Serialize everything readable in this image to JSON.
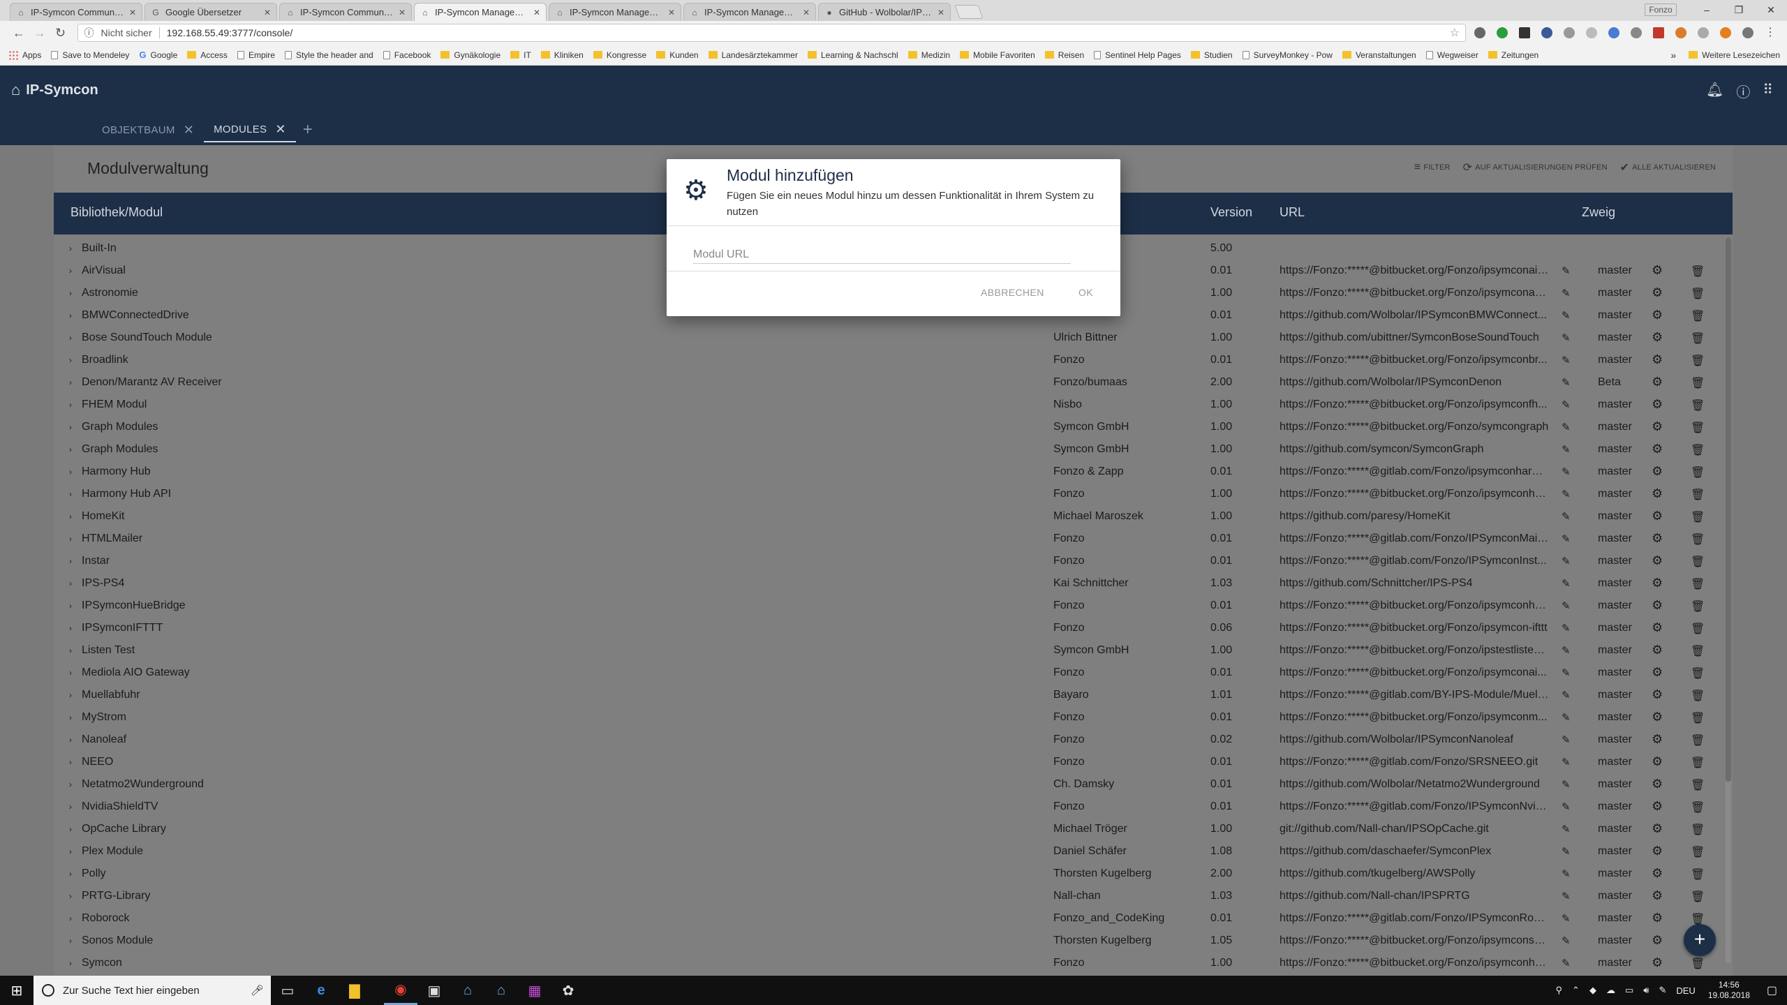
{
  "browser": {
    "tabs": [
      {
        "title": "IP-Symcon Community F",
        "icon": "home-icon",
        "active": false
      },
      {
        "title": "Google Übersetzer",
        "icon": "translate-icon",
        "active": false
      },
      {
        "title": "IP-Symcon Community F",
        "icon": "home-icon",
        "active": false
      },
      {
        "title": "IP-Symcon Management",
        "icon": "home-icon",
        "active": true
      },
      {
        "title": "IP-Symcon Management",
        "icon": "home-icon",
        "active": false
      },
      {
        "title": "IP-Symcon Management",
        "icon": "home-icon",
        "active": false
      },
      {
        "title": "GitHub - Wolbolar/IPSym",
        "icon": "github-icon",
        "active": false
      }
    ],
    "user_label": "Fonzo",
    "security_label": "Nicht sicher",
    "url": "192.168.55.49:3777/console/",
    "bookmarks": [
      {
        "label": "Apps",
        "type": "apps"
      },
      {
        "label": "Save to Mendeley",
        "type": "page"
      },
      {
        "label": "Google",
        "type": "google"
      },
      {
        "label": "Access",
        "type": "folder"
      },
      {
        "label": "Empire",
        "type": "page"
      },
      {
        "label": "Style the header and",
        "type": "page"
      },
      {
        "label": "Facebook",
        "type": "page"
      },
      {
        "label": "Gynäkologie",
        "type": "folder"
      },
      {
        "label": "IT",
        "type": "folder"
      },
      {
        "label": "Kliniken",
        "type": "folder"
      },
      {
        "label": "Kongresse",
        "type": "folder"
      },
      {
        "label": "Kunden",
        "type": "folder"
      },
      {
        "label": "Landesärztekammer",
        "type": "folder"
      },
      {
        "label": "Learning & Nachschl",
        "type": "folder"
      },
      {
        "label": "Medizin",
        "type": "folder"
      },
      {
        "label": "Mobile Favoriten",
        "type": "folder"
      },
      {
        "label": "Reisen",
        "type": "folder"
      },
      {
        "label": "Sentinel Help Pages",
        "type": "page"
      },
      {
        "label": "Studien",
        "type": "folder"
      },
      {
        "label": "SurveyMonkey - Pow",
        "type": "page"
      },
      {
        "label": "Veranstaltungen",
        "type": "folder"
      },
      {
        "label": "Wegweiser",
        "type": "page"
      },
      {
        "label": "Zeitungen",
        "type": "folder"
      }
    ],
    "more_bookmarks": "»",
    "other_bookmarks": "Weitere Lesezeichen"
  },
  "app": {
    "brand": "IP-Symcon",
    "tabs": [
      {
        "label": "OBJEKTBAUM",
        "active": false
      },
      {
        "label": "MODULES",
        "active": true
      }
    ],
    "add_tab": "+"
  },
  "page": {
    "title": "Modulverwaltung",
    "actions": {
      "filter": "FILTER",
      "check_updates": "AUF AKTUALISIERUNGEN PRÜFEN",
      "update_all": "ALLE AKTUALISIEREN"
    },
    "columns": {
      "library": "Bibliothek/Modul",
      "version": "Version",
      "url": "URL",
      "branch": "Zweig"
    },
    "rows": [
      {
        "name": "Built-In",
        "author": "",
        "version": "5.00",
        "url": "",
        "branch": ""
      },
      {
        "name": "AirVisual",
        "author": "",
        "version": "0.01",
        "url": "https://Fonzo:*****@bitbucket.org/Fonzo/ipsymconair...",
        "branch": "master"
      },
      {
        "name": "Astronomie",
        "author": "",
        "version": "1.00",
        "url": "https://Fonzo:*****@bitbucket.org/Fonzo/ipsymconas...",
        "branch": "master"
      },
      {
        "name": "BMWConnectedDrive",
        "author": "",
        "version": "0.01",
        "url": "https://github.com/Wolbolar/IPSymconBMWConnect...",
        "branch": "master"
      },
      {
        "name": "Bose SoundTouch Module",
        "author": "Ulrich Bittner",
        "version": "1.00",
        "url": "https://github.com/ubittner/SymconBoseSoundTouch",
        "branch": "master"
      },
      {
        "name": "Broadlink",
        "author": "Fonzo",
        "version": "0.01",
        "url": "https://Fonzo:*****@bitbucket.org/Fonzo/ipsymconbr...",
        "branch": "master"
      },
      {
        "name": "Denon/Marantz AV Receiver",
        "author": "Fonzo/bumaas",
        "version": "2.00",
        "url": "https://github.com/Wolbolar/IPSymconDenon",
        "branch": "Beta"
      },
      {
        "name": "FHEM Modul",
        "author": "Nisbo",
        "version": "1.00",
        "url": "https://Fonzo:*****@bitbucket.org/Fonzo/ipsymconfh...",
        "branch": "master"
      },
      {
        "name": "Graph Modules",
        "author": "Symcon GmbH",
        "version": "1.00",
        "url": "https://Fonzo:*****@bitbucket.org/Fonzo/symcongraph",
        "branch": "master"
      },
      {
        "name": "Graph Modules",
        "author": "Symcon GmbH",
        "version": "1.00",
        "url": "https://github.com/symcon/SymconGraph",
        "branch": "master"
      },
      {
        "name": "Harmony Hub",
        "author": "Fonzo & Zapp",
        "version": "0.01",
        "url": "https://Fonzo:*****@gitlab.com/Fonzo/ipsymconharm...",
        "branch": "master"
      },
      {
        "name": "Harmony Hub API",
        "author": "Fonzo",
        "version": "1.00",
        "url": "https://Fonzo:*****@bitbucket.org/Fonzo/ipsymconha...",
        "branch": "master"
      },
      {
        "name": "HomeKit",
        "author": "Michael Maroszek",
        "version": "1.00",
        "url": "https://github.com/paresy/HomeKit",
        "branch": "master"
      },
      {
        "name": "HTMLMailer",
        "author": "Fonzo",
        "version": "0.01",
        "url": "https://Fonzo:*****@gitlab.com/Fonzo/IPSymconMail...",
        "branch": "master"
      },
      {
        "name": "Instar",
        "author": "Fonzo",
        "version": "0.01",
        "url": "https://Fonzo:*****@gitlab.com/Fonzo/IPSymconInst...",
        "branch": "master"
      },
      {
        "name": "IPS-PS4",
        "author": "Kai Schnittcher",
        "version": "1.03",
        "url": "https://github.com/Schnittcher/IPS-PS4",
        "branch": "master"
      },
      {
        "name": "IPSymconHueBridge",
        "author": "Fonzo",
        "version": "0.01",
        "url": "https://Fonzo:*****@bitbucket.org/Fonzo/ipsymconha...",
        "branch": "master"
      },
      {
        "name": "IPSymconIFTTT",
        "author": "Fonzo",
        "version": "0.06",
        "url": "https://Fonzo:*****@bitbucket.org/Fonzo/ipsymcon-ifttt",
        "branch": "master"
      },
      {
        "name": "Listen Test",
        "author": "Symcon GmbH",
        "version": "1.00",
        "url": "https://Fonzo:*****@bitbucket.org/Fonzo/ipstestlisten...",
        "branch": "master"
      },
      {
        "name": "Mediola AIO Gateway",
        "author": "Fonzo",
        "version": "0.01",
        "url": "https://Fonzo:*****@bitbucket.org/Fonzo/ipsymconai...",
        "branch": "master"
      },
      {
        "name": "Muellabfuhr",
        "author": "Bayaro",
        "version": "1.01",
        "url": "https://Fonzo:*****@gitlab.com/BY-IPS-Module/Muell...",
        "branch": "master"
      },
      {
        "name": "MyStrom",
        "author": "Fonzo",
        "version": "0.01",
        "url": "https://Fonzo:*****@bitbucket.org/Fonzo/ipsymconm...",
        "branch": "master"
      },
      {
        "name": "Nanoleaf",
        "author": "Fonzo",
        "version": "0.02",
        "url": "https://github.com/Wolbolar/IPSymconNanoleaf",
        "branch": "master"
      },
      {
        "name": "NEEO",
        "author": "Fonzo",
        "version": "0.01",
        "url": "https://Fonzo:*****@gitlab.com/Fonzo/SRSNEEO.git",
        "branch": "master"
      },
      {
        "name": "Netatmo2Wunderground",
        "author": "Ch. Damsky",
        "version": "0.01",
        "url": "https://github.com/Wolbolar/Netatmo2Wunderground",
        "branch": "master"
      },
      {
        "name": "NvidiaShieldTV",
        "author": "Fonzo",
        "version": "0.01",
        "url": "https://Fonzo:*****@gitlab.com/Fonzo/IPSymconNvid...",
        "branch": "master"
      },
      {
        "name": "OpCache Library",
        "author": "Michael Tröger",
        "version": "1.00",
        "url": "git://github.com/Nall-chan/IPSOpCache.git",
        "branch": "master"
      },
      {
        "name": "Plex Module",
        "author": "Daniel Schäfer",
        "version": "1.08",
        "url": "https://github.com/daschaefer/SymconPlex",
        "branch": "master"
      },
      {
        "name": "Polly",
        "author": "Thorsten Kugelberg",
        "version": "2.00",
        "url": "https://github.com/tkugelberg/AWSPolly",
        "branch": "master"
      },
      {
        "name": "PRTG-Library",
        "author": "Nall-chan",
        "version": "1.03",
        "url": "https://github.com/Nall-chan/IPSPRTG",
        "branch": "master"
      },
      {
        "name": "Roborock",
        "author": "Fonzo_and_CodeKing",
        "version": "0.01",
        "url": "https://Fonzo:*****@gitlab.com/Fonzo/IPSymconRob...",
        "branch": "master"
      },
      {
        "name": "Sonos Module",
        "author": "Thorsten Kugelberg",
        "version": "1.05",
        "url": "https://Fonzo:*****@bitbucket.org/Fonzo/ipsymconso...",
        "branch": "master"
      },
      {
        "name": "Symcon",
        "author": "Fonzo",
        "version": "1.00",
        "url": "https://Fonzo:*****@bitbucket.org/Fonzo/ipsymconho...",
        "branch": "master"
      }
    ],
    "fab": "+"
  },
  "dialog": {
    "title": "Modul hinzufügen",
    "subtitle": "Fügen Sie ein neues Modul hinzu um dessen Funktionalität in Ihrem System zu nutzen",
    "input_placeholder": "Modul URL",
    "input_value": "",
    "cancel_label": "ABBRECHEN",
    "ok_label": "OK"
  },
  "taskbar": {
    "search_placeholder": "Zur Suche Text hier eingeben",
    "language": "DEU",
    "time": "14:56",
    "date": "19.08.2018"
  },
  "colors": {
    "header_bg": "#1d2f47",
    "overlay": "#7f7f7f"
  }
}
